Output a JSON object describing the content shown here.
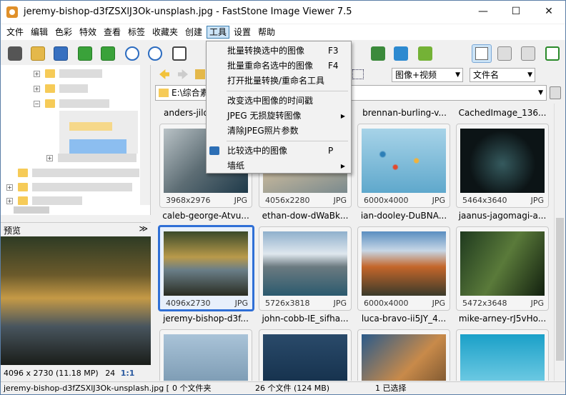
{
  "window": {
    "title": "jeremy-bishop-d3fZSXlJ3Ok-unsplash.jpg  -  FastStone Image Viewer 7.5",
    "minimize_glyph": "—",
    "maximize_glyph": "☐",
    "close_glyph": "✕"
  },
  "menu": [
    "文件",
    "编辑",
    "色彩",
    "特效",
    "查看",
    "标签",
    "收藏夹",
    "创建",
    "工具",
    "设置",
    "帮助"
  ],
  "tools_menu": {
    "items": [
      {
        "label": "批量转换选中的图像",
        "shortcut": "F3"
      },
      {
        "label": "批量重命名选中的图像",
        "shortcut": "F4"
      },
      {
        "label": "打开批量转换/重命名工具",
        "shortcut": ""
      },
      {
        "label": "改变选中图像的时间戳",
        "shortcut": ""
      },
      {
        "label": "JPEG 无损旋转图像",
        "shortcut": "",
        "submenu": true
      },
      {
        "label": "清除JPEG照片参数",
        "shortcut": ""
      },
      {
        "label": "比较选中的图像",
        "shortcut": "P"
      },
      {
        "label": "墙纸",
        "shortcut": "",
        "submenu": true
      }
    ]
  },
  "path_bar": {
    "value": "E:\\综合素"
  },
  "filter_combo": "图像+视频",
  "sort_combo": "文件名",
  "panels": {
    "preview_label": "预览",
    "preview_collapse": "≫"
  },
  "preview_status": {
    "dimensions": "4096 x 2730 (11.18 MP)",
    "depth": "24",
    "zoom": "1:1"
  },
  "thumbnails": [
    {
      "name": "anders-jilden...",
      "dims": "",
      "ext": ""
    },
    {
      "name": "brennan-burling-v...",
      "dims": "",
      "ext": ""
    },
    {
      "name": "CachedImage_136...",
      "dims": "",
      "ext": ""
    },
    {
      "name": "caleb-george-Atvu...",
      "dims": "3968x2976",
      "ext": "JPG"
    },
    {
      "name": "ethan-dow-dWaBk...",
      "dims": "4056x2280",
      "ext": "JPG"
    },
    {
      "name": "ian-dooley-DuBNA...",
      "dims": "6000x4000",
      "ext": "JPG"
    },
    {
      "name": "jaanus-jagomagi-a...",
      "dims": "5464x3640",
      "ext": "JPG"
    },
    {
      "name": "jeremy-bishop-d3f...",
      "dims": "4096x2730",
      "ext": "JPG"
    },
    {
      "name": "john-cobb-IE_sifha...",
      "dims": "5726x3818",
      "ext": "JPG"
    },
    {
      "name": "luca-bravo-ii5JY_4...",
      "dims": "6000x4000",
      "ext": "JPG"
    },
    {
      "name": "mike-arney-rJ5vHo...",
      "dims": "5472x3648",
      "ext": "JPG"
    }
  ],
  "status": {
    "file": "jeremy-bishop-d3fZSXlJ3Ok-unsplash.jpg [",
    "folders": "0 个文件夹",
    "files": "26 个文件 (124 MB)",
    "selected": "1 已选择"
  }
}
